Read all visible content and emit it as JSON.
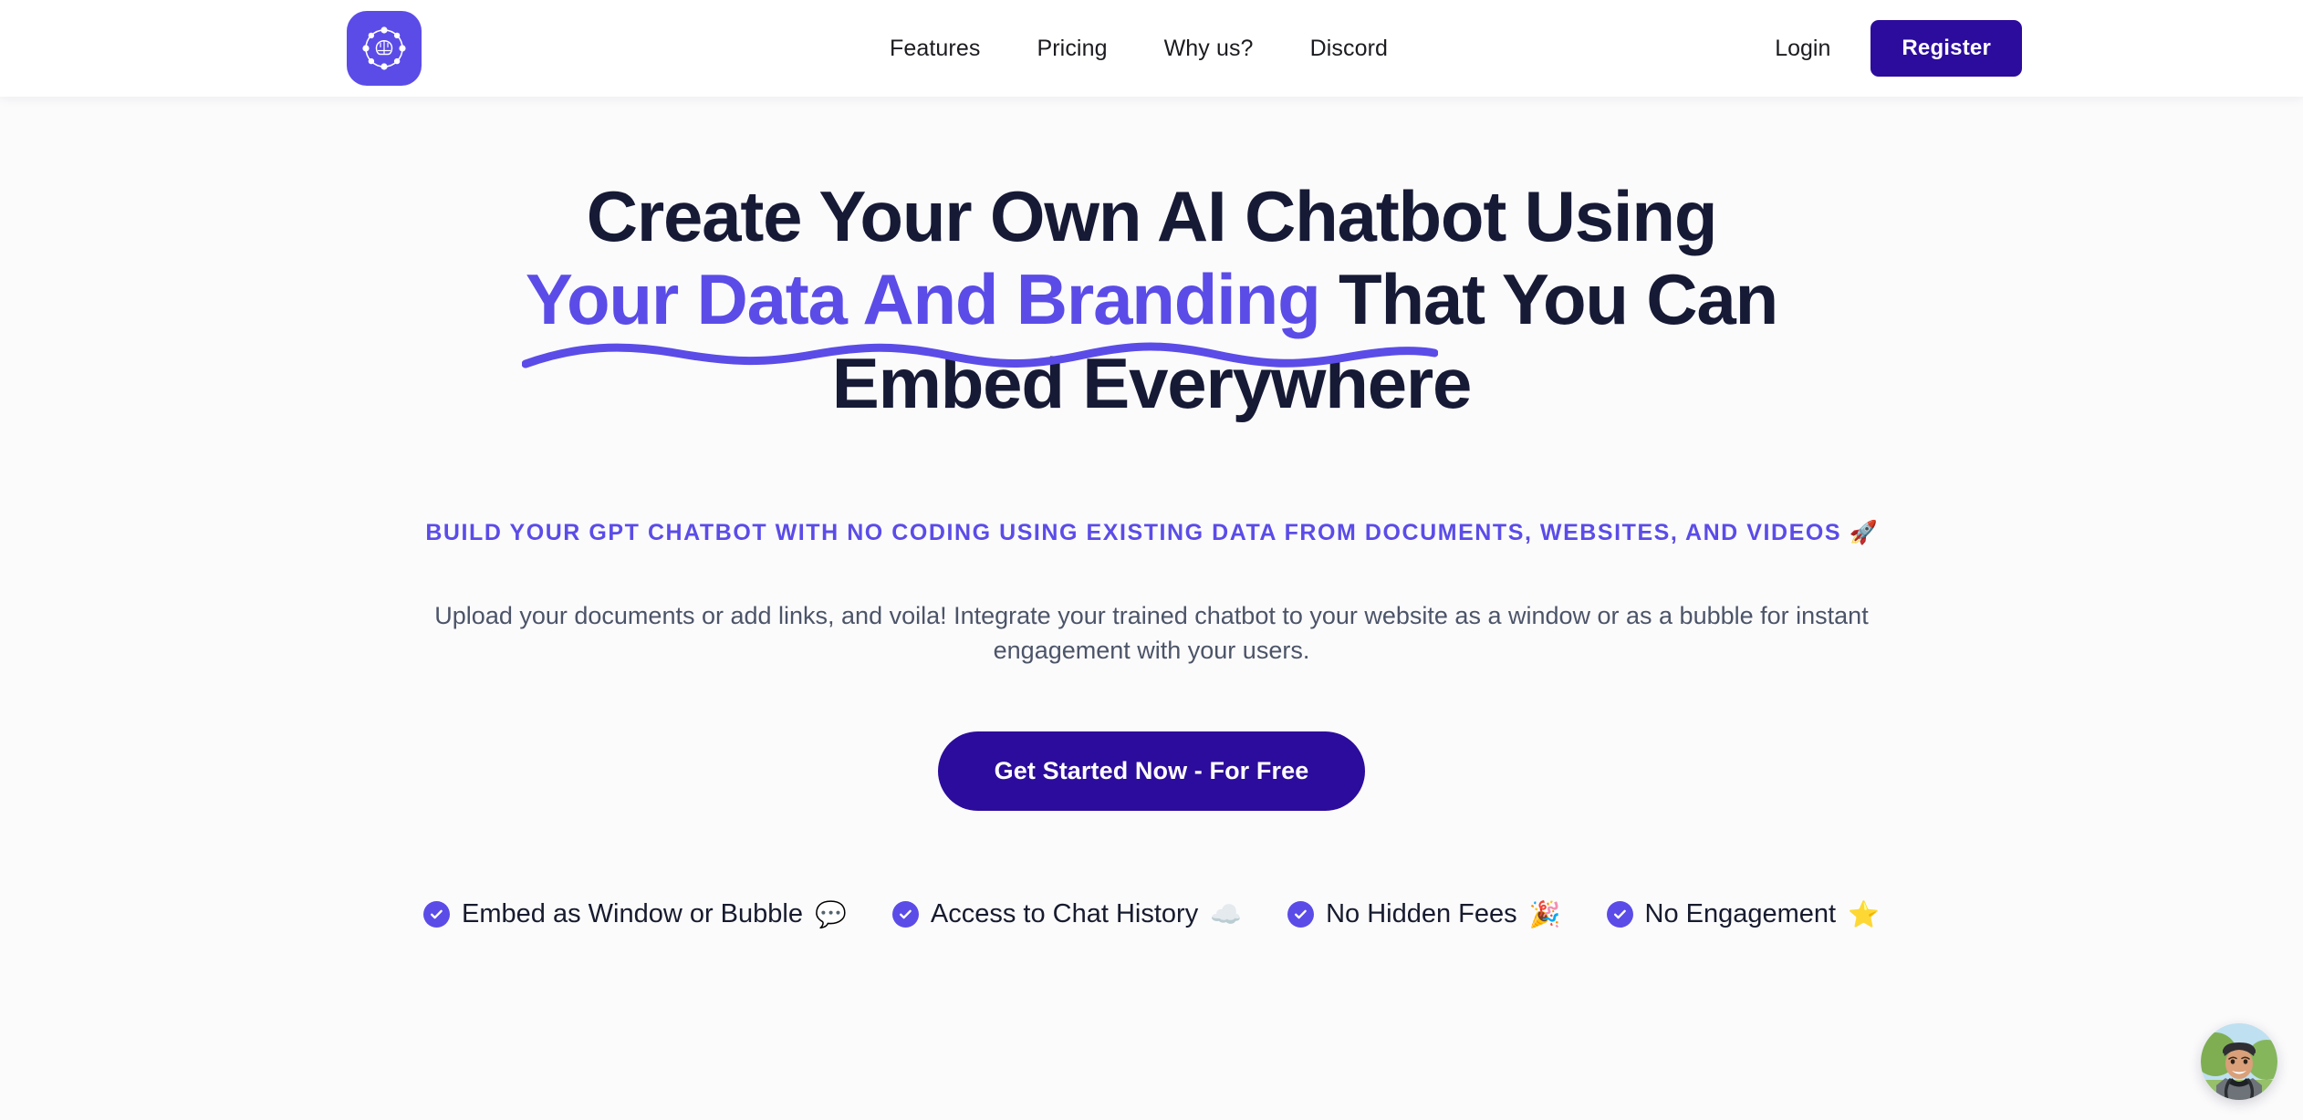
{
  "brand": {
    "logo_icon": "brain-network-icon",
    "accent_color": "#5b4ce8",
    "deep_color": "#2c0c9c",
    "headline_color": "#161a35"
  },
  "header": {
    "nav": [
      {
        "label": "Features"
      },
      {
        "label": "Pricing"
      },
      {
        "label": "Why us?"
      },
      {
        "label": "Discord"
      }
    ],
    "login_label": "Login",
    "register_label": "Register"
  },
  "hero": {
    "headline_line1": "Create Your Own AI Chatbot Using",
    "headline_accent": "Your Data And Branding",
    "headline_line2_tail": " That You Can",
    "headline_line3": "Embed Everywhere",
    "eyebrow": "Build your GPT chatbot with no coding using existing data from documents, websites, and videos",
    "eyebrow_emoji": "🚀",
    "lede": "Upload your documents or add links, and voila! Integrate your trained chatbot to your website as a window or as a bubble for instant engagement with your users.",
    "cta_label": "Get Started Now - For Free",
    "badges": [
      {
        "label": "Embed as Window or Bubble",
        "emoji": "💬",
        "icon": "check-circle-icon"
      },
      {
        "label": "Access to Chat History",
        "emoji": "☁️",
        "icon": "check-circle-icon"
      },
      {
        "label": "No Hidden Fees",
        "emoji": "🎉",
        "icon": "check-circle-icon"
      },
      {
        "label": "No Engagement",
        "emoji": "⭐",
        "icon": "check-circle-icon"
      }
    ]
  },
  "chat_widget": {
    "icon": "agent-avatar-icon"
  }
}
